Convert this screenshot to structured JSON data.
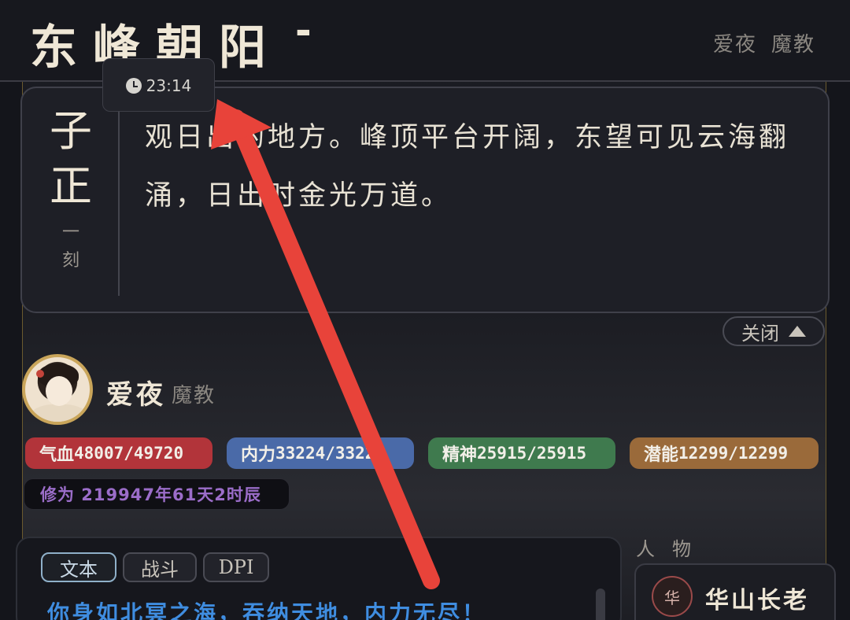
{
  "header": {
    "location_title": "东峰朝阳",
    "title_suffix": "-",
    "user_name": "爱夜",
    "user_faction": "魔教",
    "time": "23:14"
  },
  "description": {
    "time_glyph_top": "子",
    "time_glyph_bottom": "正",
    "time_sub_top": "一",
    "time_sub_bottom": "刻",
    "text": "观日出的地方。峰顶平台开阔，东望可见云海翻涌，日出时金光万道。",
    "close_label": "关闭"
  },
  "player": {
    "name": "爱夜",
    "faction": "魔教",
    "stats": [
      {
        "label": "气血",
        "value": "48007/49720",
        "color": "#b2343a"
      },
      {
        "label": "内力",
        "value": "33224/33224",
        "color": "#4a6aa8"
      },
      {
        "label": "精神",
        "value": "25915/25915",
        "color": "#3f7a4e"
      },
      {
        "label": "潜能",
        "value": "12299/12299",
        "color": "#9a6a3a"
      }
    ],
    "cultivation": "修为 219947年61天2时辰"
  },
  "log": {
    "tabs": [
      "文本",
      "战斗",
      "DPI"
    ],
    "active_tab": "文本",
    "line": "你身如北冥之海，吞纳天地，内力无尽！"
  },
  "people": {
    "title": "人物",
    "npc_badge": "华",
    "npc_name": "华山长老"
  },
  "colors": {
    "accent_gold": "#c9a55a",
    "annotation_arrow": "#e8433a"
  }
}
